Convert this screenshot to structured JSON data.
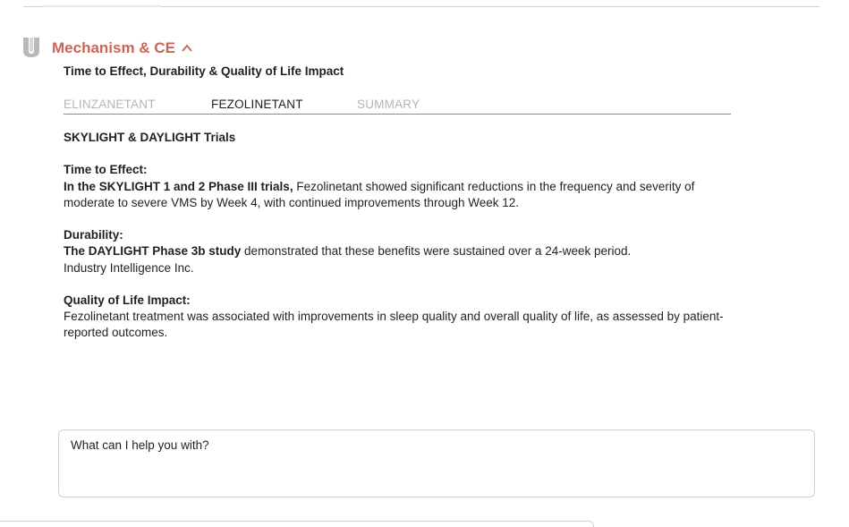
{
  "section": {
    "title": "Mechanism & CE",
    "subtitle": "Time to Effect, Durability & Quality of Life Impact"
  },
  "tabs": [
    {
      "label": "ELINZANETANT",
      "active": false
    },
    {
      "label": "FEZOLINETANT",
      "active": true
    },
    {
      "label": "SUMMARY",
      "active": false
    }
  ],
  "content": {
    "heading": "SKYLIGHT & DAYLIGHT Trials",
    "time_to_effect": {
      "label": "Time to Effect:",
      "lead": "In the SKYLIGHT 1 and 2 Phase III trials,",
      "body": " Fezolinetant showed significant reductions in the frequency and severity of moderate to severe VMS by Week 4, with continued improvements through Week 12."
    },
    "durability": {
      "label": "Durability:",
      "lead": "The DAYLIGHT Phase 3b study",
      "body": " demonstrated that these benefits were sustained over a 24-week period.",
      "source": "Industry Intelligence Inc."
    },
    "quality_of_life": {
      "label": "Quality of Life Impact:",
      "body": "Fezolinetant treatment was associated with improvements in sleep quality and overall quality of life, as assessed by patient-reported outcomes."
    }
  },
  "chat": {
    "placeholder": "What can I help you with?"
  },
  "icons": {
    "section": "section-shield-icon",
    "collapse": "chevron-up-icon"
  },
  "colors": {
    "accent": "#c8655c",
    "icon_gray": "#b9b9b9",
    "inactive_tab": "#b5b5b5"
  }
}
